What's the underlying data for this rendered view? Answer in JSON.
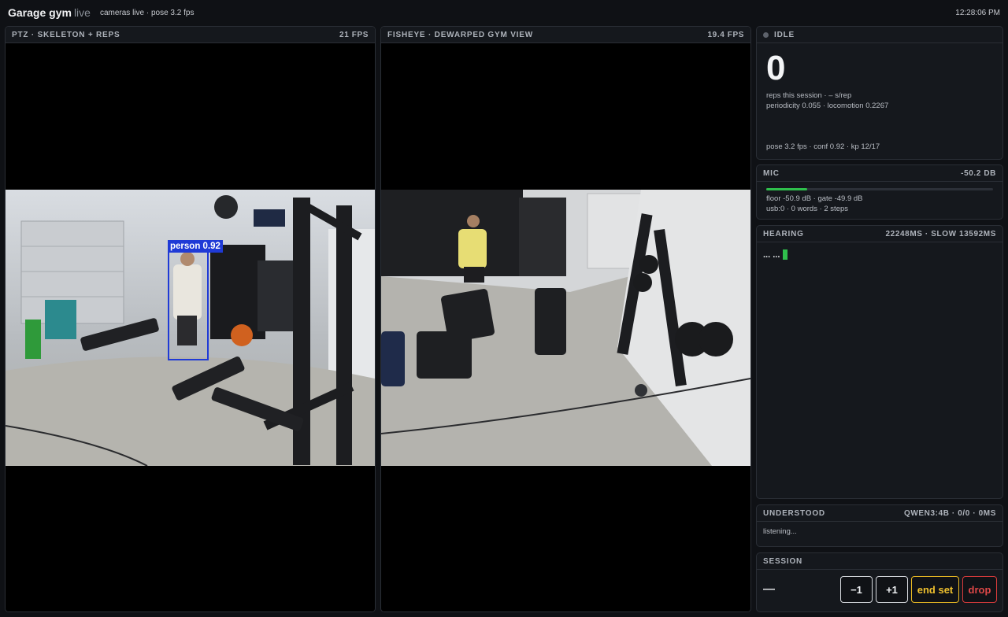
{
  "app": {
    "title": "Garage gym",
    "title_suffix": "live",
    "status": "cameras live · pose 3.2 fps",
    "clock": "12:28:06 PM"
  },
  "cameras": [
    {
      "title": "PTZ · SKELETON + REPS",
      "fps": "21 FPS",
      "detection_label": "person 0.92"
    },
    {
      "title": "FISHEYE · DEWARPED GYM VIEW",
      "fps": "19.4 FPS"
    }
  ],
  "state": {
    "label": "IDLE",
    "count": "0",
    "line1": "reps this session · – s/rep",
    "line2": "periodicity 0.055 · locomotion 0.2267",
    "footer": "pose 3.2 fps · conf 0.92 · kp 12/17"
  },
  "mic": {
    "title": "MIC",
    "level": "-50.2 DB",
    "meter_fraction": 0.18,
    "line1": "floor -50.9 dB · gate -49.9 dB",
    "line2": "usb:0 · 0 words · 2 steps"
  },
  "hearing": {
    "title": "HEARING",
    "latency": "22248MS · SLOW 13592MS",
    "text": "... ..."
  },
  "understood": {
    "title": "UNDERSTOOD",
    "model": "QWEN3:4B · 0/0 · 0MS",
    "text": "listening..."
  },
  "session": {
    "title": "SESSION",
    "value": "—",
    "buttons": {
      "minus": "−1",
      "plus": "+1",
      "end_set": "end set",
      "drop": "drop"
    }
  },
  "colors": {
    "accent_green": "#2fbf4c",
    "end_set": "#f0c12e",
    "drop": "#e04848",
    "detection_box": "#1f3ad6"
  }
}
